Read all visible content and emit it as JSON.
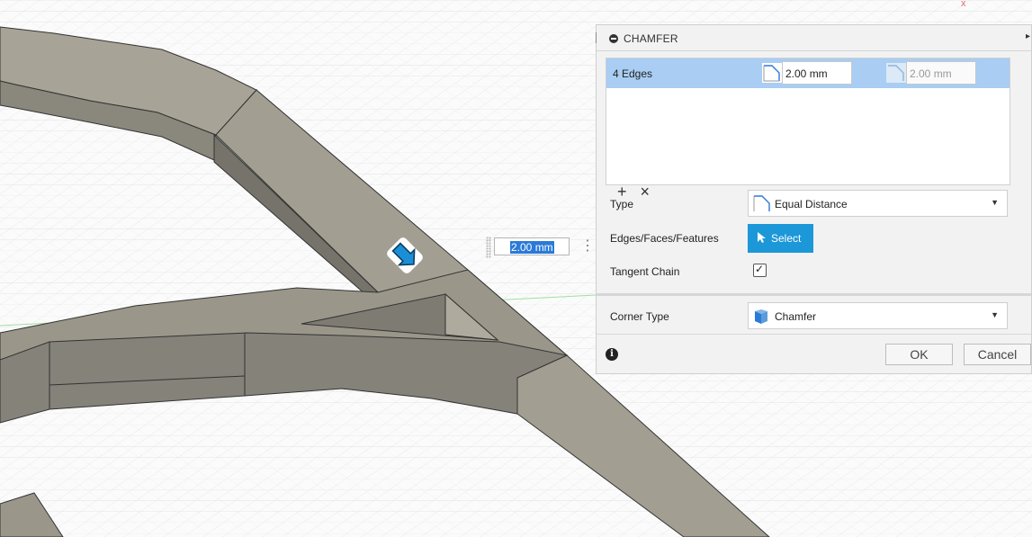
{
  "viewport": {
    "distance_box": {
      "value": "2.00 mm"
    }
  },
  "dialog": {
    "title": "CHAMFER",
    "selection": {
      "label": "4 Edges",
      "distance1": "2.00 mm",
      "distance2": "2.00 mm"
    },
    "list_tools": {
      "add": "+",
      "remove": "×"
    },
    "type": {
      "label": "Type",
      "value": "Equal Distance"
    },
    "edges": {
      "label": "Edges/Faces/Features",
      "button": "Select"
    },
    "tangent_chain": {
      "label": "Tangent Chain",
      "checked": true,
      "mark": "✓"
    },
    "corner_type": {
      "label": "Corner Type",
      "value": "Chamfer"
    },
    "info": "i",
    "ok": "OK",
    "cancel": "Cancel"
  },
  "colors": {
    "selection_row": "#a9cdf3",
    "select_button": "#1c97d8",
    "model_body": "#9a978a"
  }
}
